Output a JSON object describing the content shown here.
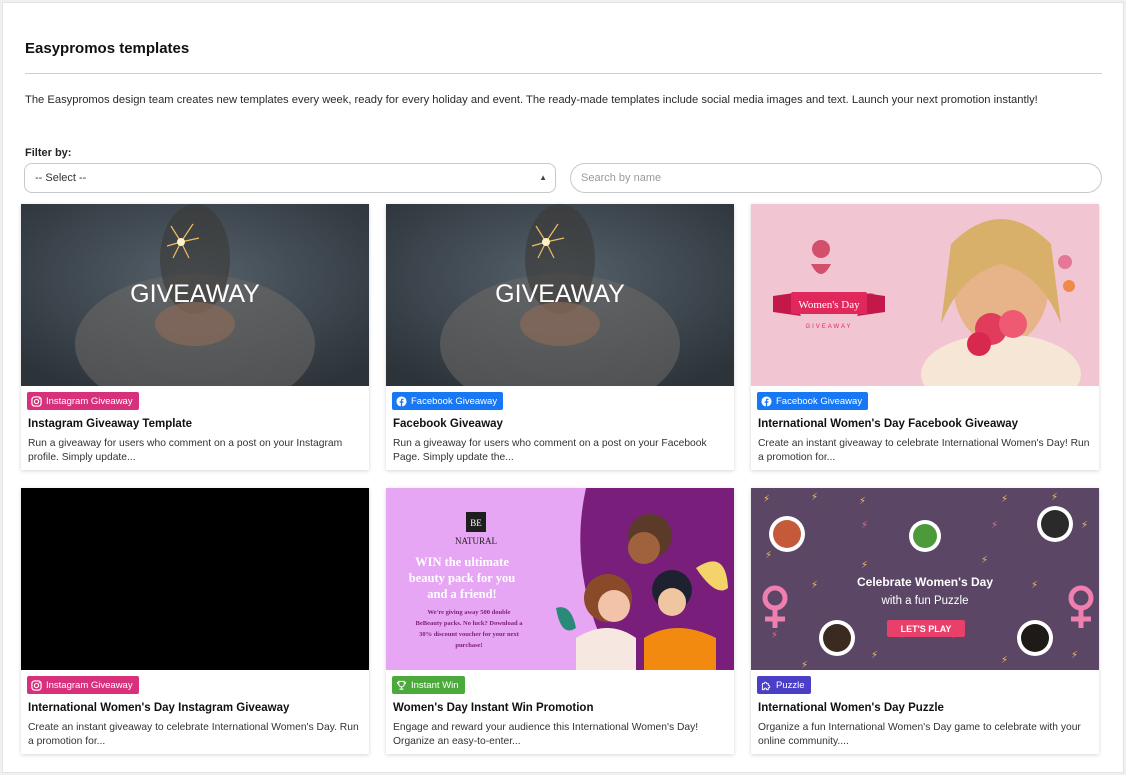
{
  "page": {
    "title": "Easypromos templates",
    "intro": "The Easypromos design team creates new templates every week, ready for every holiday and event. The ready-made templates include social media images and text. Launch your next promotion instantly!",
    "filter_label": "Filter by:",
    "select_value": "-- Select --",
    "search_placeholder": "Search by name"
  },
  "colors": {
    "instagram": "#d7317c",
    "facebook": "#1877f2",
    "instant_win": "#4caa3c",
    "puzzle": "#4b3fc8"
  },
  "cards": [
    {
      "badge": "Instagram Giveaway",
      "badge_icon": "instagram-icon",
      "title": "Instagram Giveaway Template",
      "desc": "Run a giveaway for users who comment on a post on your Instagram profile. Simply update...",
      "image_text": "GIVEAWAY"
    },
    {
      "badge": "Facebook Giveaway",
      "badge_icon": "facebook-icon",
      "title": "Facebook Giveaway",
      "desc": "Run a giveaway for users who comment on a post on your Facebook Page. Simply update the...",
      "image_text": "GIVEAWAY"
    },
    {
      "badge": "Facebook Giveaway",
      "badge_icon": "facebook-icon",
      "title": "International Women's Day Facebook Giveaway",
      "desc": "Create an instant giveaway to celebrate International Women's Day! Run a promotion for...",
      "image_text": "Women's Day",
      "image_subtext": "GIVEAWAY"
    },
    {
      "badge": "Instagram Giveaway",
      "badge_icon": "instagram-icon",
      "title": "International Women's Day Instagram Giveaway",
      "desc": "Create an instant giveaway to celebrate International Women's Day. Run a promotion for..."
    },
    {
      "badge": "Instant Win",
      "badge_icon": "trophy-icon",
      "title": "Women's Day Instant Win Promotion",
      "desc": "Engage and reward your audience this International Women's Day! Organize an easy-to-enter...",
      "image_logo": "BE",
      "image_brand": "NATURAL",
      "image_headline": [
        "WIN the ultimate",
        "beauty pack for you",
        "and a friend!"
      ],
      "image_body": [
        "We're giving away 500 double",
        "BeBeauty packs. No luck? Download a",
        "30% discount voucher for your next",
        "purchase!"
      ]
    },
    {
      "badge": "Puzzle",
      "badge_icon": "puzzle-icon",
      "title": "International Women's Day Puzzle",
      "desc": "Organize a fun International Women's Day game to celebrate with your online community....",
      "image_headline": "Celebrate Women's Day",
      "image_sub": "with a fun Puzzle",
      "image_button": "LET'S PLAY"
    }
  ]
}
